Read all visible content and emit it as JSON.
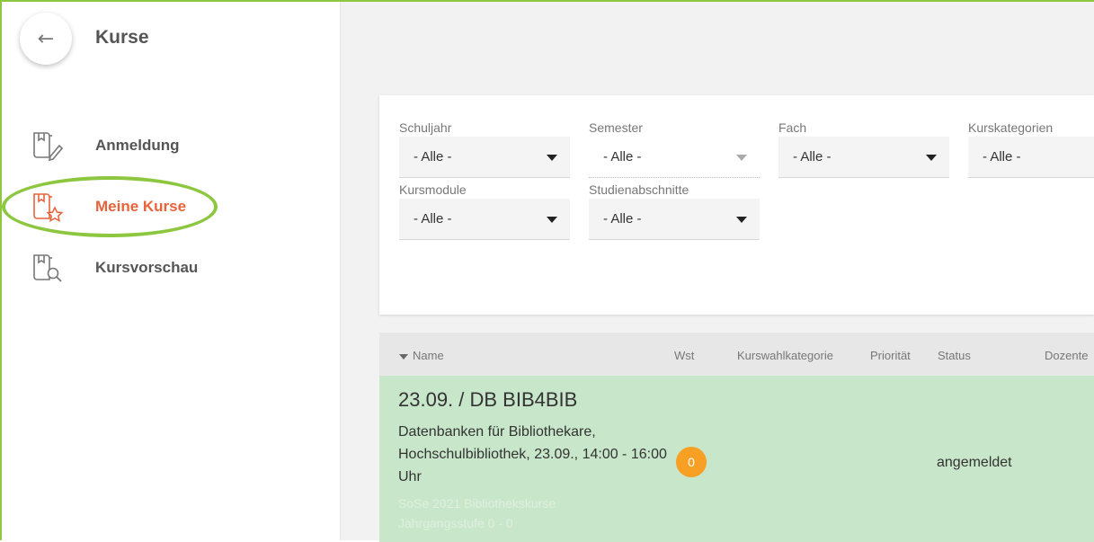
{
  "header": {
    "title": "Kurse",
    "back_icon": "arrow-left-icon",
    "back_glyph": "←"
  },
  "sidebar": {
    "items": [
      {
        "label": "Anmeldung",
        "icon": "book-pencil-icon",
        "active": false
      },
      {
        "label": "Meine Kurse",
        "icon": "book-star-icon",
        "active": true
      },
      {
        "label": "Kursvorschau",
        "icon": "book-search-icon",
        "active": false
      }
    ]
  },
  "filters": [
    {
      "label": "Schuljahr",
      "value": "- Alle -"
    },
    {
      "label": "Semester",
      "value": "- Alle -",
      "disabled": true
    },
    {
      "label": "Fach",
      "value": "- Alle -"
    },
    {
      "label": "Kurskategorien",
      "value": "- Alle -"
    },
    {
      "label": "Kursmodule",
      "value": "- Alle -"
    },
    {
      "label": "Studienabschnitte",
      "value": "- Alle -"
    }
  ],
  "table": {
    "columns": [
      "Name",
      "Wst",
      "Kurswahlkategorie",
      "Priorität",
      "Status",
      "Dozente"
    ],
    "rows": [
      {
        "code": "23.09. / DB BIB4BIB",
        "description": "Datenbanken für Bibliothekare, Hochschulbibliothek, 23.09., 14:00 - 16:00 Uhr",
        "meta_line1": "SoSe 2021 Bibliothekskurse",
        "meta_line2": "Jahrgangsstufe 0 - 0",
        "wst": "0",
        "status": "angemeldet"
      }
    ]
  },
  "colors": {
    "accent": "#e8633a",
    "highlight": "#8dc63f",
    "row_background": "#c8e6c9",
    "badge": "#f7a024"
  }
}
